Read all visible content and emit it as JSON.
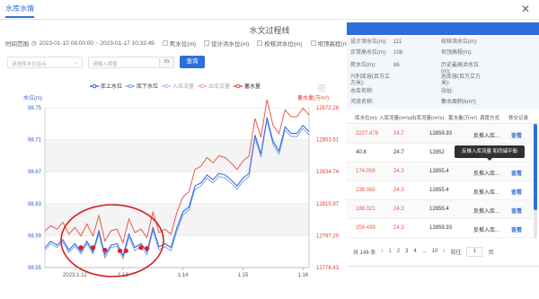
{
  "window": {
    "tab": "水库水情",
    "close_icon": "close-icon"
  },
  "page_title": "水文过程线",
  "filter": {
    "time_label": "时间范围",
    "time_range": "2023-01-10 08:00:00 ~ 2023-01-17 10:33:49",
    "checks": [
      "死水位(m)",
      "设计洪水位(m)",
      "校核洪水位(m)",
      "坝顶高程(m)"
    ]
  },
  "search": {
    "select_placeholder": "请选择水位站点",
    "input_placeholder": "请输入阈值",
    "unit": "m",
    "button": "查询"
  },
  "legend": [
    "库上水位",
    "库下水位",
    "入库流量",
    "出库流量",
    "蓄水量"
  ],
  "colors": {
    "up_level": "#2f5fd6",
    "down_level": "#6c9bf2",
    "inflow": "#a9c3f3",
    "outflow": "#f3a5a0",
    "storage": "#e04030",
    "circle": "#d91f1f"
  },
  "chart_data": {
    "type": "line",
    "ylabel": "水位(m)",
    "y2label": "蓄水量(万m³)",
    "ylim": [
      98.55,
      98.75
    ],
    "y2lim": [
      12778.43,
      12872.28
    ],
    "yticks": [
      "98.75",
      "98.71",
      "98.67",
      "98.63",
      "98.59",
      "98.55"
    ],
    "y2ticks": [
      "12872.28",
      "12853.51",
      "12834.74",
      "12815.97",
      "12797.20",
      "12778.43"
    ],
    "xticks": [
      "2023.1.12",
      "1.13",
      "1.14",
      "1.15",
      "1.16"
    ],
    "xticks_x": [
      0.2,
      1,
      2,
      3,
      4
    ],
    "xlim": [
      -0.3,
      4.1
    ],
    "series": [
      {
        "name": "库上水位",
        "x": [
          -0.3,
          -0.2,
          -0.1,
          0.0,
          0.1,
          0.2,
          0.3,
          0.4,
          0.5,
          0.6,
          0.7,
          0.8,
          0.9,
          1.0,
          1.1,
          1.2,
          1.3,
          1.4,
          1.5,
          1.6,
          1.7,
          1.8,
          1.9,
          2.0,
          2.1,
          2.2,
          2.3,
          2.4,
          2.5,
          2.6,
          2.7,
          2.8,
          2.9,
          3.0,
          3.1,
          3.2,
          3.3,
          3.4,
          3.5,
          3.6,
          3.7,
          3.8,
          3.9,
          4.0,
          4.1
        ],
        "values": [
          98.575,
          98.583,
          98.578,
          98.585,
          98.572,
          98.58,
          98.57,
          98.583,
          98.57,
          98.596,
          98.566,
          98.578,
          98.58,
          98.565,
          98.592,
          98.575,
          98.58,
          98.57,
          98.6,
          98.576,
          98.58,
          98.575,
          98.6,
          98.62,
          98.626,
          98.652,
          98.656,
          98.666,
          98.66,
          98.668,
          98.666,
          98.66,
          98.652,
          98.662,
          98.668,
          98.716,
          98.692,
          98.738,
          98.708,
          98.696,
          98.726,
          98.718,
          98.718,
          98.728,
          98.72
        ]
      },
      {
        "name": "库下水位",
        "x": [
          -0.3,
          -0.2,
          -0.1,
          0.0,
          0.1,
          0.2,
          0.3,
          0.4,
          0.5,
          0.6,
          0.7,
          0.8,
          0.9,
          1.0,
          1.1,
          1.2,
          1.3,
          1.4,
          1.5,
          1.6,
          1.7,
          1.8,
          1.9,
          2.0,
          2.1,
          2.2,
          2.3,
          2.4,
          2.5,
          2.6,
          2.7,
          2.8,
          2.9,
          3.0,
          3.1,
          3.2,
          3.3,
          3.4,
          3.5,
          3.6,
          3.7,
          3.8,
          3.9,
          4.0,
          4.1
        ],
        "values": [
          98.572,
          98.58,
          98.575,
          98.582,
          98.569,
          98.577,
          98.567,
          98.58,
          98.567,
          98.592,
          98.562,
          98.575,
          98.577,
          98.561,
          98.588,
          98.571,
          98.577,
          98.566,
          98.596,
          98.572,
          98.576,
          98.571,
          98.596,
          98.616,
          98.622,
          98.648,
          98.652,
          98.662,
          98.656,
          98.664,
          98.662,
          98.656,
          98.648,
          98.658,
          98.664,
          98.712,
          98.688,
          98.734,
          98.704,
          98.692,
          98.722,
          98.714,
          98.714,
          98.724,
          98.716
        ]
      },
      {
        "name": "蓄水量",
        "x": [
          -0.3,
          -0.2,
          -0.1,
          0.0,
          0.1,
          0.2,
          0.3,
          0.4,
          0.5,
          0.6,
          0.7,
          0.8,
          0.9,
          1.0,
          1.1,
          1.2,
          1.3,
          1.4,
          1.5,
          1.6,
          1.7,
          1.8,
          1.9,
          2.0,
          2.1,
          2.2,
          2.3,
          2.4,
          2.5,
          2.6,
          2.7,
          2.8,
          2.9,
          3.0,
          3.1,
          3.2,
          3.3,
          3.4,
          3.5,
          3.6,
          3.7,
          3.8,
          3.9,
          4.0,
          4.1
        ],
        "values": [
          12800,
          12803,
          12801,
          12805,
          12798,
          12802,
          12797,
          12804,
          12797,
          12809,
          12794,
          12800,
          12801,
          12793,
          12807,
          12799,
          12801,
          12796,
          12811,
          12799,
          12801,
          12798,
          12811,
          12820,
          12823,
          12836,
          12838,
          12843,
          12840,
          12844,
          12843,
          12840,
          12836,
          12841,
          12844,
          12866,
          12855,
          12877,
          12862,
          12857,
          12871,
          12867,
          12867,
          12872,
          12868
        ]
      }
    ],
    "markers": {
      "x": [
        0.3,
        0.5,
        0.7,
        0.95,
        1.05,
        1.3,
        1.4
      ],
      "values": [
        98.575,
        98.575,
        98.572,
        98.571,
        98.571,
        98.575,
        98.574
      ]
    }
  },
  "info": [
    [
      "设计洪水位(m):",
      "111",
      "校核洪水位(m):",
      ""
    ],
    [
      "正常高水位(m):",
      "108",
      "坝顶高程(m):",
      ""
    ],
    [
      "死水位(m):",
      "86",
      "历史最高洪水位(m):",
      ""
    ],
    [
      "兴利库容(百万立方米):",
      "",
      "总库容(百万立方米):",
      ""
    ],
    [
      "水库名称:",
      "",
      "站址:",
      ""
    ],
    [
      "河流名称:",
      "",
      "集水面积(km²):",
      ""
    ]
  ],
  "table": {
    "headers": [
      "库水位(m)",
      "入库流量(m³/s)",
      "出库流量(m³/s)",
      "蓄水量(万m³)",
      "调度方式",
      "移交记录"
    ],
    "rows": [
      {
        "c1": "2227.478",
        "c2": "24.7",
        "c3": "12859.93",
        "c4": "反推入库...",
        "c5": "查看",
        "hl": true
      },
      {
        "c1": "40.8",
        "c2": "24.7",
        "c3": "12852",
        "c4": "反推入库...",
        "c5": "查看",
        "hl": false
      },
      {
        "c1": "174.058",
        "c2": "24.3",
        "c3": "12855.4",
        "c4": "反推入库...",
        "c5": "查看",
        "hl": true
      },
      {
        "c1": "238.065",
        "c2": "24.3",
        "c3": "12855.4",
        "c4": "反推入库...",
        "c5": "查看",
        "hl": true
      },
      {
        "c1": "188.321",
        "c2": "24.3",
        "c3": "12855.4",
        "c4": "反推入库...",
        "c5": "查看",
        "hl": true
      },
      {
        "c1": "259.439",
        "c2": "24.3",
        "c3": "12859.93",
        "c4": "反推入库...",
        "c5": "查看",
        "hl": true
      }
    ],
    "tooltip": "反推入库流量 和同储平衡"
  },
  "pager": {
    "total": "共 146 条",
    "pages": [
      "1",
      "2",
      "3",
      "4",
      "...",
      "10"
    ],
    "goto": "前往",
    "page": "1",
    "suffix": "页"
  }
}
